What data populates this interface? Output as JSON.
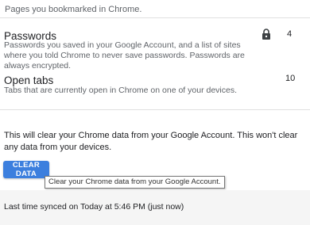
{
  "bookmarks": {
    "description_fragment": "Pages you bookmarked in Chrome."
  },
  "passwords": {
    "title": "Passwords",
    "description": "Passwords you saved in your Google Account, and a list of sites where you told Chrome to never save passwords. Passwords are always encrypted.",
    "count": "4",
    "icon": "lock-icon"
  },
  "open_tabs": {
    "title": "Open tabs",
    "description": "Tabs that are currently open in Chrome on one of your devices.",
    "count": "10"
  },
  "clear_data": {
    "message": "This will clear your Chrome data from your Google Account. This won't clear any data from your devices.",
    "button_label": "CLEAR DATA",
    "tooltip": "Clear your Chrome data from your Google Account."
  },
  "sync": {
    "status": "Last time synced on Today at 5:46 PM (just now)"
  },
  "colors": {
    "accent": "#3c7fde",
    "secondary_text": "#5f6368",
    "footer_bg": "#f5f5f5"
  }
}
